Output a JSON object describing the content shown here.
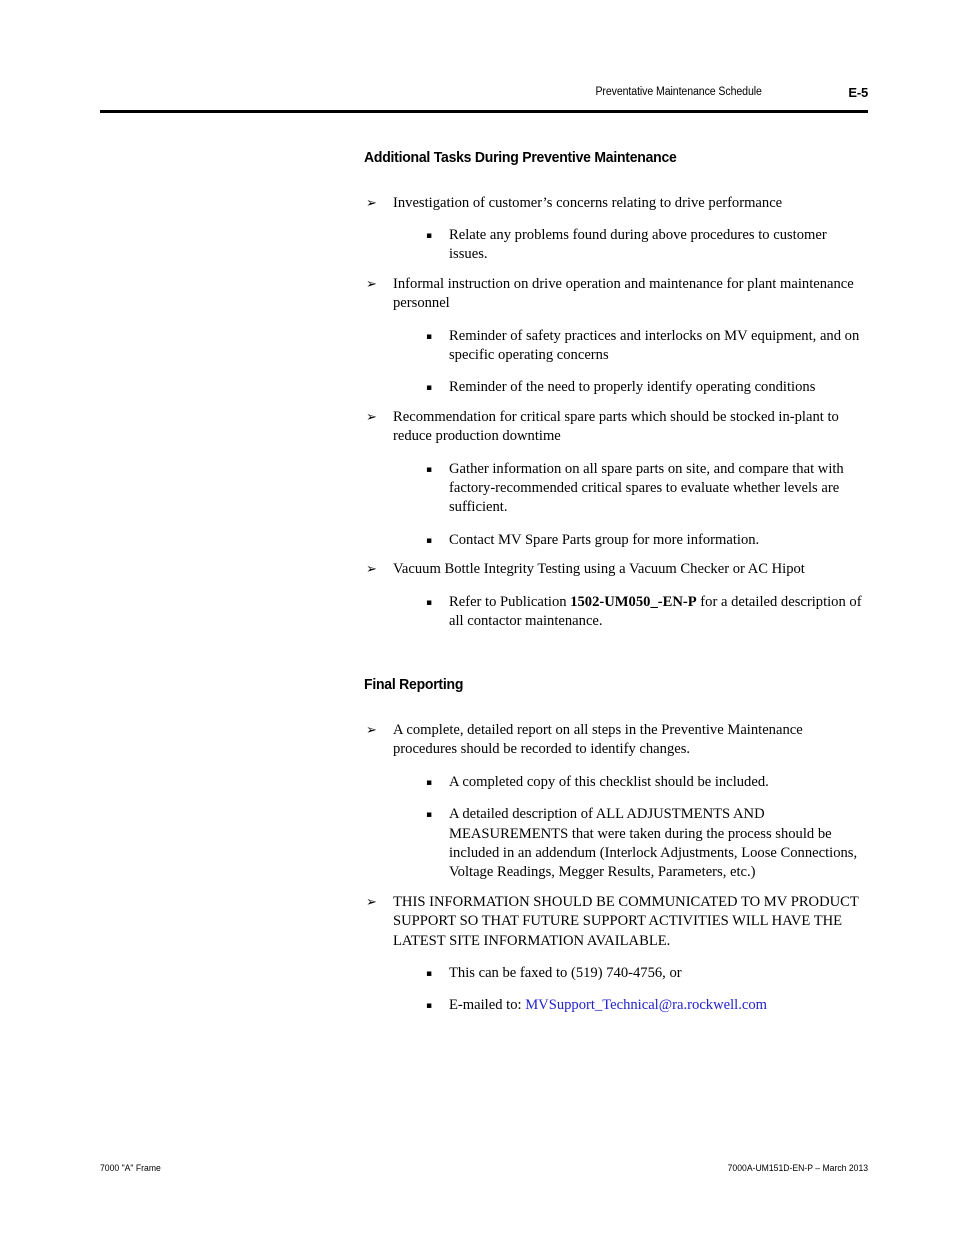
{
  "header": {
    "title": "Preventative Maintenance Schedule",
    "page_number": "E-5"
  },
  "colors": {
    "link": "#2222cc",
    "text": "#000000",
    "rule": "#000000"
  },
  "markers": {
    "level1": "➢",
    "level2": "▪"
  },
  "sections": [
    {
      "heading": "Additional Tasks During Preventive Maintenance",
      "items": [
        {
          "text": "Investigation of customer’s concerns relating to drive performance",
          "sub": [
            "Relate any problems found during above procedures to customer issues."
          ]
        },
        {
          "text": "Informal instruction on drive operation and maintenance for plant maintenance personnel",
          "sub": [
            "Reminder of safety practices and interlocks on MV equipment, and on specific operating concerns",
            "Reminder of the need to properly identify operating conditions"
          ]
        },
        {
          "text": "Recommendation for critical spare parts which should be stocked in-plant to reduce production downtime",
          "sub": [
            "Gather information on all spare parts on site, and compare that with factory-recommended critical spares to evaluate whether levels are sufficient.",
            "Contact MV Spare Parts group for more information."
          ]
        },
        {
          "text": "Vacuum Bottle Integrity Testing using a Vacuum Checker or AC Hipot",
          "sub_rich": [
            {
              "before": "Refer to Publication ",
              "bold": "1502-UM050_-EN-P",
              "after": " for a detailed description of all contactor maintenance."
            }
          ]
        }
      ]
    },
    {
      "heading": "Final Reporting",
      "items": [
        {
          "text": "A complete, detailed report on all steps in the Preventive Maintenance procedures should be recorded to identify changes.",
          "sub": [
            "A completed copy of this checklist should be included.",
            "A detailed description of ALL ADJUSTMENTS AND MEASUREMENTS that were taken during the process should be included in an addendum (Interlock Adjustments, Loose Connections, Voltage Readings, Megger Results, Parameters, etc.)"
          ]
        },
        {
          "text": "THIS INFORMATION SHOULD BE COMMUNICATED TO MV PRODUCT SUPPORT SO THAT FUTURE SUPPORT ACTIVITIES WILL HAVE THE LATEST SITE INFORMATION AVAILABLE.",
          "sub": [
            "This can be faxed to (519) 740-4756, or"
          ],
          "sub_link": {
            "prefix": "E-mailed to:  ",
            "link_text": "MVSupport_Technical@ra.rockwell.com"
          }
        }
      ]
    }
  ],
  "footer": {
    "left": "7000 \"A\" Frame",
    "right": "7000A-UM151D-EN-P – March 2013"
  }
}
